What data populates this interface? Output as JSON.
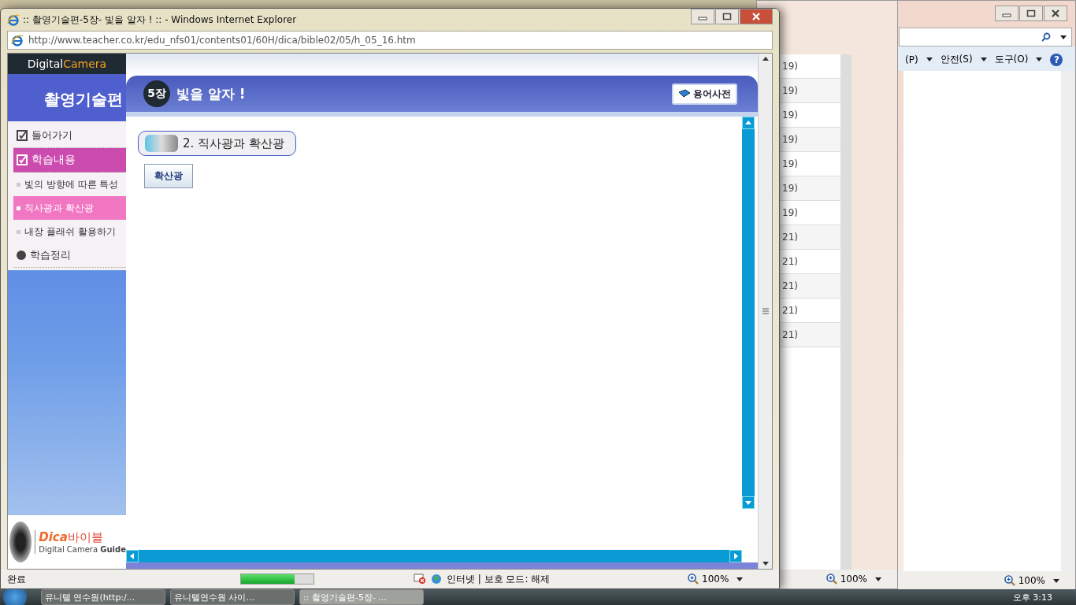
{
  "front_window": {
    "title": ":: 촬영기술편-5장- 빛을 알자 ! :: - Windows Internet Explorer",
    "address": "http://www.teacher.co.kr/edu_nfs01/contents01/60H/dica/bible02/05/h_05_16.htm",
    "brand": {
      "part_a": "Digital",
      "part_b": "Camera"
    },
    "section_title": "촬영기술편",
    "nav": [
      {
        "label": "들어가기",
        "kind": "section",
        "selected": false
      },
      {
        "label": "학습내용",
        "kind": "section",
        "selected": true
      },
      {
        "label": "빛의 방향에 따른 특성",
        "kind": "topic",
        "selected": false
      },
      {
        "label": "직사광과 확산광",
        "kind": "topic",
        "selected": true
      },
      {
        "label": "내장 플래쉬 활용하기",
        "kind": "topic",
        "selected": false
      },
      {
        "label": "학습정리",
        "kind": "summary",
        "selected": false
      }
    ],
    "chapter_badge": "5장",
    "chapter_title": "빛을 알자 !",
    "glossary_button": "용어사전",
    "lesson_title": "2. 직사광과 확산광",
    "tab_button": "확산광",
    "footer_logo": {
      "dica": "Dica",
      "bible": "바이블",
      "guide_a": "Digital Camera",
      "guide_b": "Guide"
    },
    "status": {
      "text": "완료",
      "progress": {
        "level": 0.74
      },
      "zone": "인터넷 | 보호 모드: 해제",
      "zoom": "100%"
    }
  },
  "middle_window": {
    "rows": [
      "19)",
      "19)",
      "19)",
      "19)",
      "19)",
      "19)",
      "19)",
      "21)",
      "21)",
      "21)",
      "21)",
      "21)"
    ],
    "zoom": "100%"
  },
  "back_window": {
    "menu": [
      "(P)",
      "안전(S)",
      "도구(O)"
    ],
    "help": "?",
    "zoom": "100%"
  },
  "taskbar": {
    "buttons": [
      {
        "label": "유니텔 연수원(http:/...",
        "selected": false
      },
      {
        "label": "유니텔연수원 사이...",
        "selected": false
      },
      {
        "label": ":: 촬영기술편-5장- ...",
        "selected": true
      }
    ],
    "clock": "오후 3:13"
  }
}
